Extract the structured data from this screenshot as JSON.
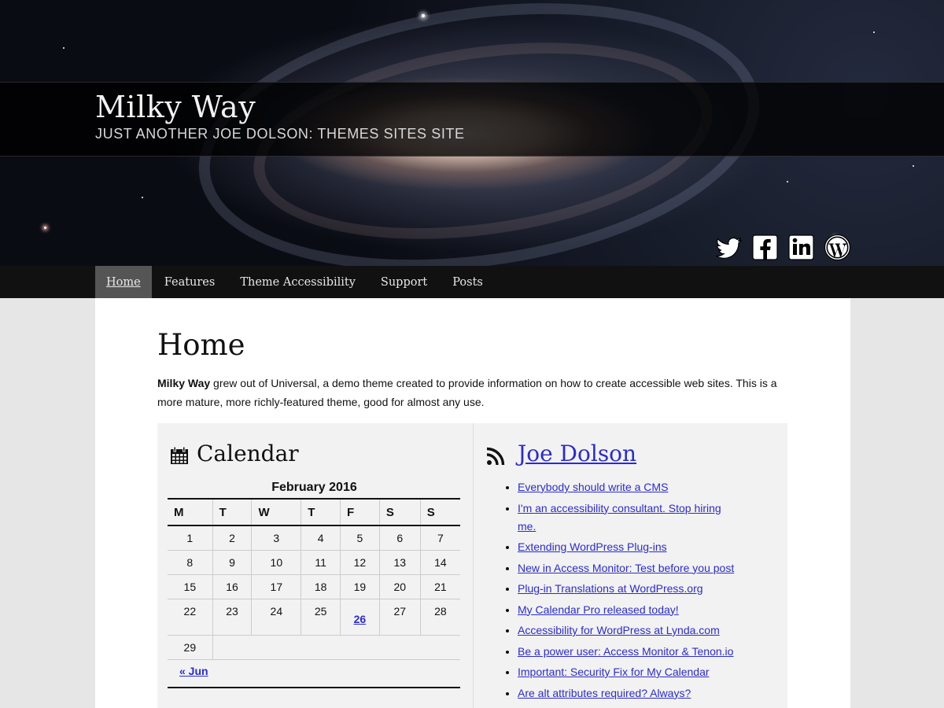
{
  "site": {
    "title": "Milky Way",
    "description": "JUST ANOTHER JOE DOLSON: THEMES SITES SITE"
  },
  "social": [
    {
      "icon": "twitter-icon"
    },
    {
      "icon": "facebook-icon"
    },
    {
      "icon": "linkedin-icon"
    },
    {
      "icon": "wordpress-icon"
    }
  ],
  "nav": {
    "items": [
      {
        "label": "Home",
        "active": true
      },
      {
        "label": "Features"
      },
      {
        "label": "Theme Accessibility"
      },
      {
        "label": "Support"
      },
      {
        "label": "Posts"
      }
    ]
  },
  "page": {
    "title": "Home",
    "intro_bold": "Milky Way",
    "intro_rest": " grew out of Universal, a demo theme created to provide information on how to create accessible web sites. This is a more mature, more richly-featured theme, good for almost any use."
  },
  "calendar": {
    "widget_title": "Calendar",
    "caption": "February 2016",
    "headers": [
      "M",
      "T",
      "W",
      "T",
      "F",
      "S",
      "S"
    ],
    "weeks": [
      [
        "1",
        "2",
        "3",
        "4",
        "5",
        "6",
        "7"
      ],
      [
        "8",
        "9",
        "10",
        "11",
        "12",
        "13",
        "14"
      ],
      [
        "15",
        "16",
        "17",
        "18",
        "19",
        "20",
        "21"
      ],
      [
        "22",
        "23",
        "24",
        "25",
        "26",
        "27",
        "28"
      ],
      [
        "29"
      ]
    ],
    "linked_day": "26",
    "prev_link": "« Jun"
  },
  "feed": {
    "title": "Joe Dolson",
    "items": [
      "Everybody should write a CMS",
      "I'm an accessibility consultant. Stop hiring me.",
      "Extending WordPress Plug-ins",
      "New in Access Monitor: Test before you post",
      "Plug-in Translations at WordPress.org",
      "My Calendar Pro released today!",
      "Accessibility for WordPress at Lynda.com",
      "Be a power user: Access Monitor & Tenon.io",
      "Important: Security Fix for My Calendar",
      "Are alt attributes required? Always?"
    ]
  },
  "colors": {
    "link": "#2b2bd0",
    "nav_bg": "#111111",
    "nav_active": "#555555",
    "widget_bg": "#f2f2f2"
  }
}
